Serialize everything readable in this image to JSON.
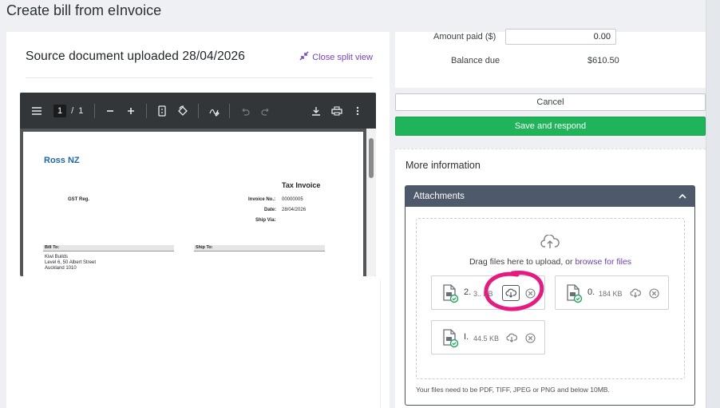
{
  "page_title": "Create bill from eInvoice",
  "left": {
    "source_title": "Source document uploaded 28/04/2026",
    "close_split": "Close split view",
    "pdf": {
      "page_current": "1",
      "page_sep": "/",
      "page_total": "1",
      "company": "Ross NZ",
      "doc_title": "Tax Invoice",
      "gst_label": "GST Reg.",
      "invoice_no_label": "Invoice No.:",
      "invoice_no": "00000005",
      "date_label": "Date:",
      "date": "28/04/2026",
      "ship_via_label": "Ship Via:",
      "bill_to_label": "Bill To:",
      "ship_to_label": "Ship To:",
      "bill_to_lines": [
        "Kiwi Builds",
        "Level 6, 50 Albert Street",
        "Auckland  1010"
      ]
    }
  },
  "payment": {
    "amount_paid_label": "Amount paid ($)",
    "amount_paid_value": "0.00",
    "balance_due_label": "Balance due",
    "balance_due_value": "$610.50"
  },
  "buttons": {
    "cancel": "Cancel",
    "save": "Save and respond"
  },
  "more_info": {
    "title": "More information",
    "attachments": {
      "header": "Attachments",
      "drag_text": "Drag files here to upload, or ",
      "browse_text": "browse for files",
      "files": [
        {
          "name": "2.",
          "size": "3.. KB"
        },
        {
          "name": "0.",
          "size": "184 KB"
        },
        {
          "name": "I.",
          "size": "44.5 KB"
        }
      ],
      "note": "Your files need to be PDF, TIFF, JPEG or PNG and below 10MB."
    }
  },
  "colors": {
    "accent_purple": "#7a3fd6",
    "save_green": "#1fb35a",
    "header_slate": "#4e5a6b",
    "annotation_pink": "#e8197f"
  }
}
